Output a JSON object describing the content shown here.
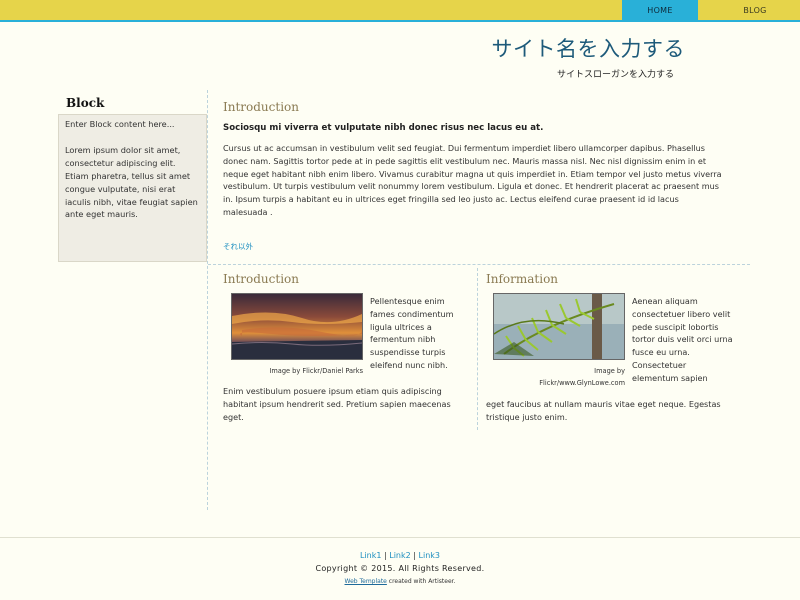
{
  "nav": {
    "home": "HOME",
    "blog": "BLOG"
  },
  "header": {
    "site_name": "サイト名を入力する",
    "slogan": "サイトスローガンを入力する"
  },
  "sidebar": {
    "title": "Block",
    "content_1": "Enter Block content here...",
    "content_2": "Lorem ipsum dolor sit amet, consectetur adipiscing elit. Etiam pharetra, tellus sit amet congue vulputate, nisi erat iaculis nibh, vitae feugiat sapien ante eget mauris."
  },
  "main": {
    "heading": "Introduction",
    "lead": "Sociosqu mi viverra et vulputate nibh donec risus nec lacus eu at.",
    "body": "Cursus ut ac accumsan in vestibulum velit sed feugiat. Dui fermentum imperdiet libero ullamcorper dapibus. Phasellus donec nam. Sagittis tortor pede at in pede sagittis elit vestibulum nec. Mauris massa nisl. Nec nisl dignissim enim in et neque eget habitant nibh enim libero. Vivamus curabitur magna ut quis imperdiet in. Etiam tempor vel justo metus viverra vestibulum. Ut turpis vestibulum velit nonummy lorem vestibulum. Ligula et donec. Et hendrerit placerat ac praesent mus in. Ipsum turpis a habitant eu in ultrices eget fringilla sed leo justo ac. Lectus eleifend curae praesent id id lacus malesuada .",
    "more_link": "それ以外"
  },
  "col_left": {
    "heading": "Introduction",
    "caption": "Image by Flickr/Daniel Parks",
    "text_side": "Pellentesque enim fames condimentum ligula ultrices a fermentum nibh suspendisse turpis eleifend nunc nibh.",
    "text_below": "Enim vestibulum posuere ipsum etiam quis adipiscing habitant ipsum hendrerit sed. Pretium sapien maecenas eget."
  },
  "col_right": {
    "heading": "Information",
    "caption_1": "Image by",
    "caption_2": "Flickr/www.GlynLowe.com",
    "text_side": "Aenean aliquam consectetuer libero velit pede suscipit lobortis tortor duis velit orci urna fusce eu urna. Consectetuer elementum sapien",
    "text_below": "eget faucibus at nullam mauris vitae eget neque. Egestas tristique justo enim."
  },
  "footer": {
    "link1": "Link1",
    "sep": "|",
    "link2": "Link2",
    "link3": "Link3",
    "copyright": "Copyright © 2015. All Rights Reserved.",
    "credit_link": "Web Template",
    "credit_text": "created with Artisteer."
  }
}
